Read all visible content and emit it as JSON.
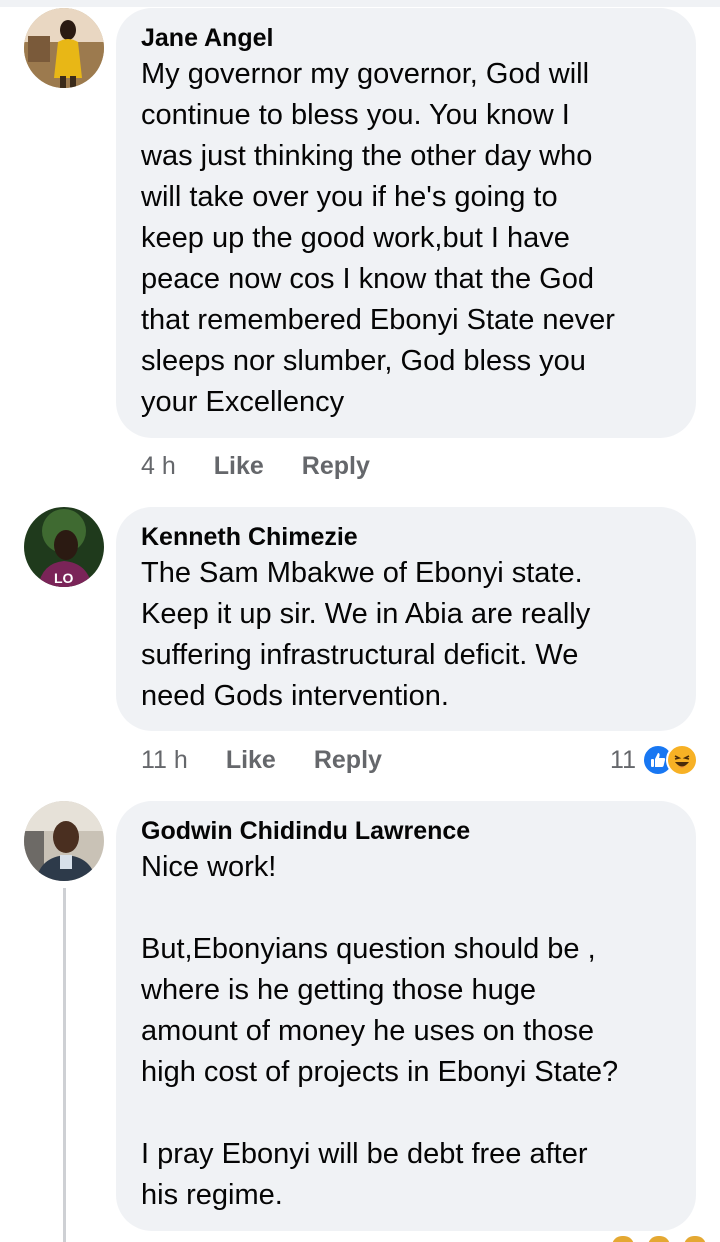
{
  "comments": [
    {
      "author": "Jane Angel",
      "text": "My governor my governor, God will\ncontinue to bless you. You know I\nwas just thinking the other day who\nwill take over you if he's going to\nkeep up the good work,but I have\npeace now cos I know that the God\nthat remembered Ebonyi State never\nsleeps nor slumber, God bless you\nyour Excellency",
      "time": "4 h",
      "like_label": "Like",
      "reply_label": "Reply"
    },
    {
      "author": "Kenneth Chimezie",
      "text": "The Sam Mbakwe of Ebonyi state.\nKeep it up sir. We in Abia are really\nsuffering infrastructural deficit. We\nneed Gods intervention.",
      "time": "11 h",
      "like_label": "Like",
      "reply_label": "Reply",
      "reaction_count": "11",
      "reaction_icons": [
        "like-icon",
        "haha-icon"
      ],
      "avatar_shirt_text": "LO"
    },
    {
      "author": "Godwin Chidindu Lawrence",
      "text": "Nice work!\n\nBut,Ebonyians  question should be ,\nwhere is he getting those huge\namount of money he uses on those\nhigh cost of projects in Ebonyi State?\n\nI pray Ebonyi will be debt free after\nhis regime."
    }
  ],
  "colors": {
    "bubble": "#f0f2f5",
    "meta_text": "#65676b",
    "like_blue": "#1877f2",
    "haha_yellow": "#f7b125"
  }
}
